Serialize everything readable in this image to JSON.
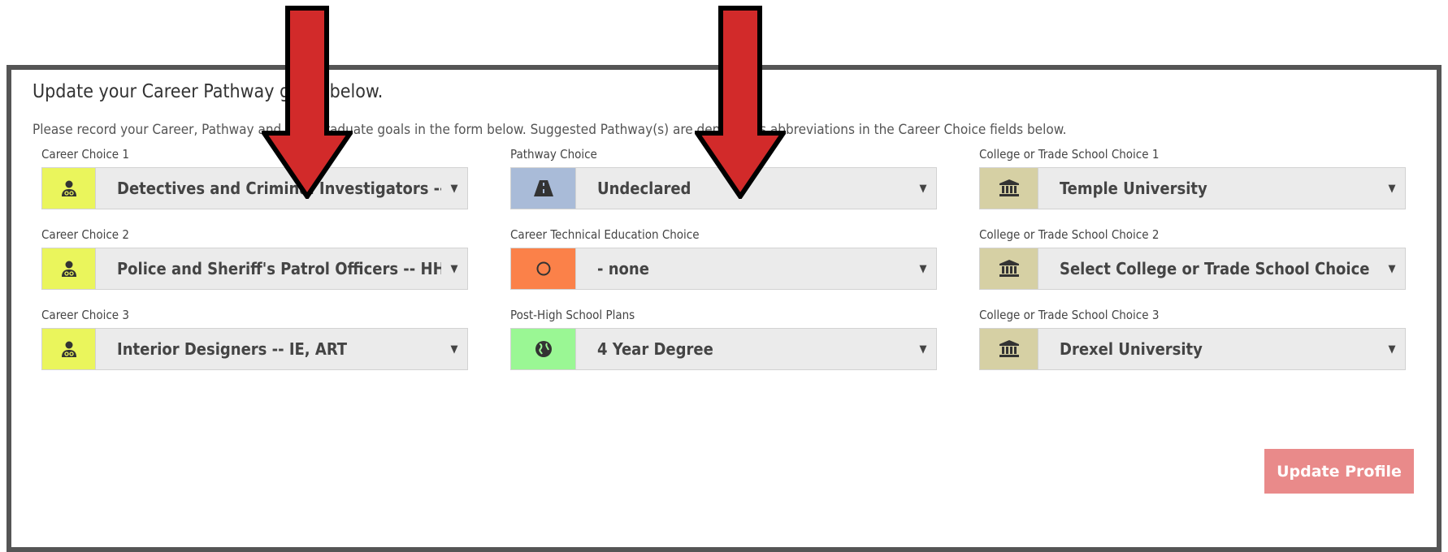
{
  "heading": "Update your Career Pathway goals below.",
  "subtext": "Please record your Career, Pathway and Post Graduate goals in the form below. Suggested Pathway(s) are denoted as abbreviations in the Career Choice fields below.",
  "columns": {
    "career": [
      {
        "label": "Career Choice 1",
        "value": "Detectives and Criminal Investigators -- H",
        "icon": "user-doctor-icon"
      },
      {
        "label": "Career Choice 2",
        "value": "Police and Sheriff's Patrol Officers -- HHS",
        "icon": "user-doctor-icon"
      },
      {
        "label": "Career Choice 3",
        "value": "Interior Designers -- IE, ART",
        "icon": "user-doctor-icon"
      }
    ],
    "middle": [
      {
        "label": "Pathway Choice",
        "value": "Undeclared",
        "icon": "road-icon"
      },
      {
        "label": "Career Technical Education Choice",
        "value": "- none",
        "icon": "circle-icon"
      },
      {
        "label": "Post-High School Plans",
        "value": "4 Year Degree",
        "icon": "globe-icon"
      }
    ],
    "college": [
      {
        "label": "College or Trade School Choice 1",
        "value": "Temple University",
        "icon": "bank-icon"
      },
      {
        "label": "College or Trade School Choice 2",
        "value": "Select College or Trade School Choice",
        "icon": "bank-icon"
      },
      {
        "label": "College or Trade School Choice 3",
        "value": "Drexel University",
        "icon": "bank-icon"
      }
    ]
  },
  "caret": "▼",
  "update_button": "Update Profile",
  "colors": {
    "career_addon": "#eaf55c",
    "pathway_addon": "#a9bbd8",
    "cte_addon": "#fb8149",
    "plans_addon": "#9af794",
    "college_addon": "#d6d0a4",
    "button": "#e98a8a",
    "arrow": "#d22a2a",
    "panel_border": "#555555"
  }
}
